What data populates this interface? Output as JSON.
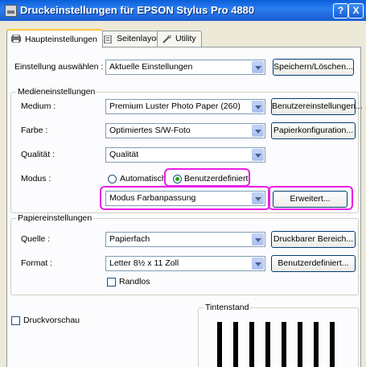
{
  "window": {
    "title": "Druckeinstellungen für EPSON Stylus Pro 4880",
    "help_label": "?",
    "close_label": "X"
  },
  "tabs": [
    {
      "label": "Haupteinstellungen",
      "icon": "printer-icon"
    },
    {
      "label": "Seitenlayout",
      "icon": "page-icon"
    },
    {
      "label": "Utility",
      "icon": "wrench-icon"
    }
  ],
  "setting": {
    "label": "Einstellung auswählen :",
    "value": "Aktuelle Einstellungen",
    "save_button": "Speichern/Löschen..."
  },
  "media": {
    "group_title": "Medieneinstellungen",
    "medium_label": "Medium :",
    "medium_value": "Premium Luster Photo Paper (260)",
    "custom_button": "Benutzereinstellungen...",
    "color_label": "Farbe :",
    "color_value": "Optimiertes S/W-Foto",
    "paper_config_button": "Papierkonfiguration...",
    "quality_label": "Qualität :",
    "quality_value": "Qualität",
    "mode_label": "Modus :",
    "mode_auto": "Automatisch",
    "mode_custom": "Benutzerdefiniert",
    "mode_select_value": "Modus Farbanpassung",
    "advanced_button": "Erweitert..."
  },
  "paper": {
    "group_title": "Papiereinstellungen",
    "source_label": "Quelle :",
    "source_value": "Papierfach",
    "printable_button": "Druckbarer Bereich...",
    "format_label": "Format :",
    "format_value": "Letter 8½ x 11 Zoll",
    "custom_format_button": "Benutzerdefiniert...",
    "borderless_label": "Randlos"
  },
  "preview": {
    "label": "Druckvorschau"
  },
  "ink": {
    "group_title": "Tintenstand"
  },
  "colors": {
    "highlight": "#e91ee6",
    "titlebar": "#0a5fd8"
  }
}
